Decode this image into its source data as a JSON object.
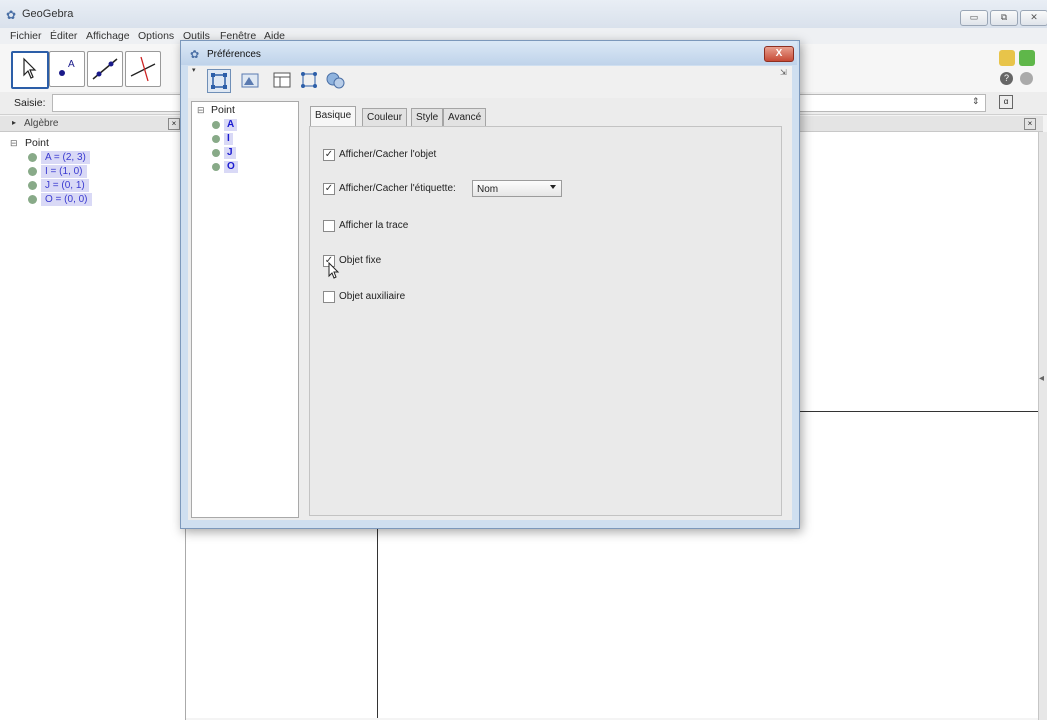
{
  "app": {
    "title": "GeoGebra",
    "menu": [
      "Fichier",
      "Éditer",
      "Affichage",
      "Options",
      "Outils",
      "Fenêtre",
      "Aide"
    ],
    "window_buttons": [
      "▭",
      "⧉",
      "✕"
    ]
  },
  "input_bar": {
    "label": "Saisie:",
    "value": ""
  },
  "algebra": {
    "title": "Algèbre",
    "group": "Point",
    "items": [
      "A = (2, 3)",
      "I = (1, 0)",
      "J = (0, 1)",
      "O = (0, 0)"
    ]
  },
  "dialog": {
    "title": "Préférences",
    "close_label": "X",
    "tree_root": "Point",
    "tree_items": [
      "A",
      "I",
      "J",
      "O"
    ],
    "tabs": [
      "Basique",
      "Couleur",
      "Style",
      "Avancé"
    ],
    "active_tab": "Basique",
    "options": [
      {
        "label": "Afficher/Cacher l'objet",
        "checked": true
      },
      {
        "label": "Afficher/Cacher l'étiquette:",
        "checked": true
      },
      {
        "label": "Afficher la trace",
        "checked": false
      },
      {
        "label": "Objet fixe",
        "checked": true
      },
      {
        "label": "Objet auxiliaire",
        "checked": false
      }
    ],
    "label_select": "Nom"
  },
  "icons": [
    "geogebra-icon",
    "arrow-cursor-icon",
    "point-tool-icon",
    "line-tool-icon",
    "perpendicular-tool-icon",
    "undo-icon",
    "redo-icon",
    "help-icon",
    "settings-icon"
  ],
  "colors": {
    "selection": "#d9d9f6",
    "point_text": "#1a1ad0",
    "dialog_frame": "#cfdff0",
    "close_button": "#c64a36"
  }
}
